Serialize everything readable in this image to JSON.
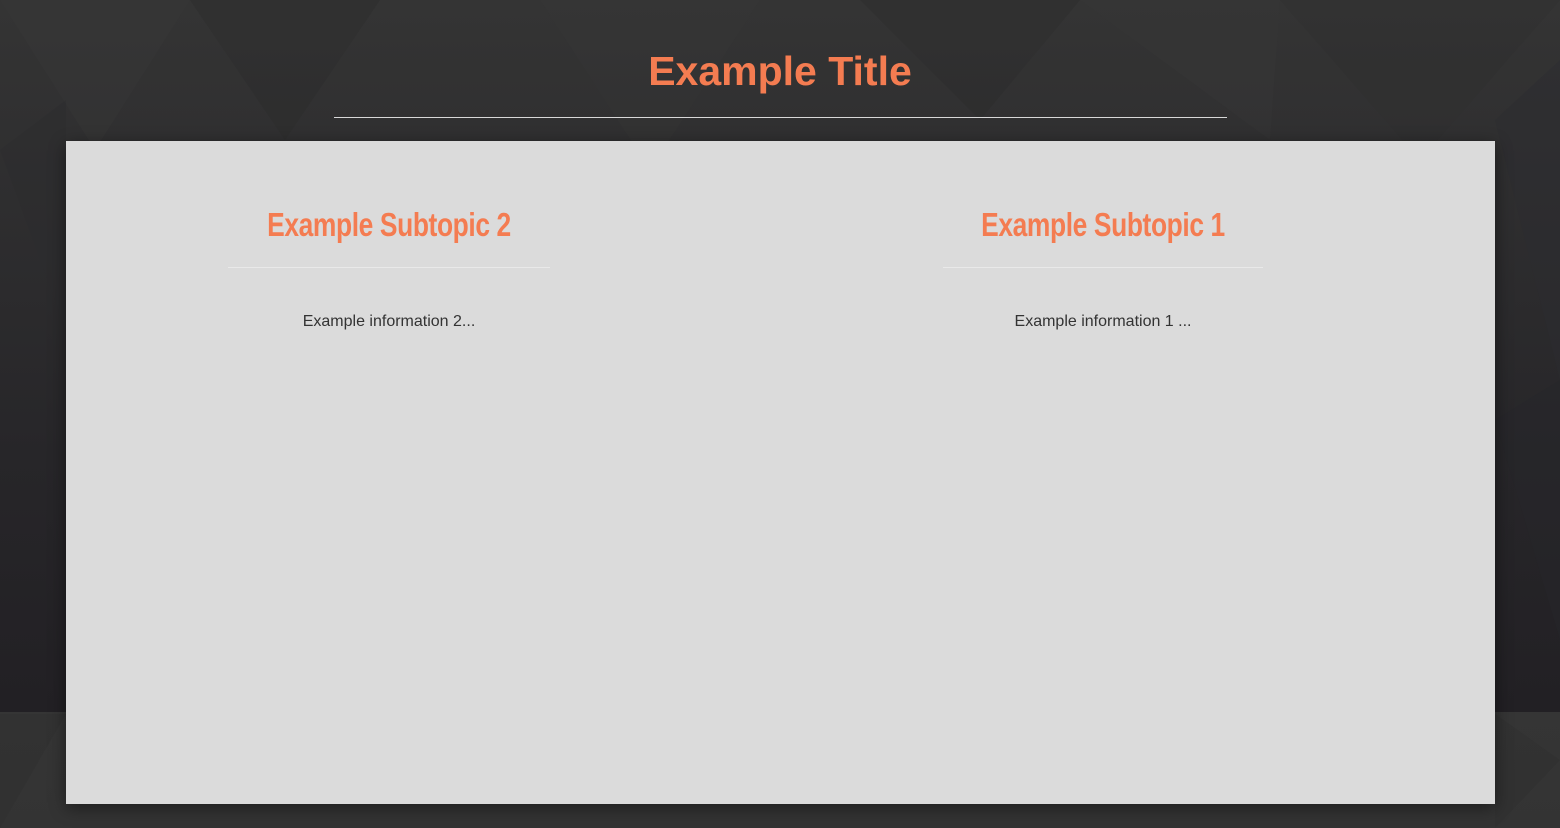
{
  "page": {
    "title": "Example Title"
  },
  "topics": [
    {
      "heading": "Example Subtopic 2",
      "info": "Example information 2..."
    },
    {
      "heading": "Example Subtopic 1",
      "info": "Example information 1 ..."
    }
  ],
  "colors": {
    "accent": "#f47c51",
    "panel": "#dbdbdb",
    "background_dark": "#232125",
    "background_light": "#353535",
    "body_text": "#333333"
  }
}
